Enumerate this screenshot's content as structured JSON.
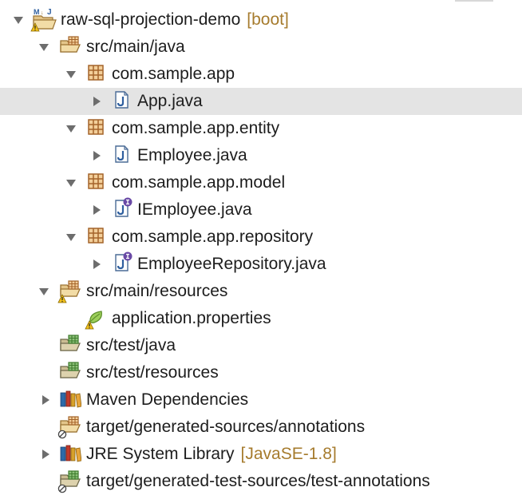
{
  "tree": {
    "project": {
      "name": "raw-sql-projection-demo",
      "decoration": "[boot]"
    },
    "src_main_java": {
      "label": "src/main/java"
    },
    "packages": [
      {
        "label": "com.sample.app",
        "file": "App.java"
      },
      {
        "label": "com.sample.app.entity",
        "file": "Employee.java"
      },
      {
        "label": "com.sample.app.model",
        "file": "IEmployee.java"
      },
      {
        "label": "com.sample.app.repository",
        "file": "EmployeeRepository.java"
      }
    ],
    "src_main_resources": {
      "label": "src/main/resources",
      "file": "application.properties"
    },
    "src_test_java": {
      "label": "src/test/java"
    },
    "src_test_resources": {
      "label": "src/test/resources"
    },
    "maven": {
      "label": "Maven Dependencies"
    },
    "target_annotations": {
      "label": "target/generated-sources/annotations"
    },
    "jre": {
      "label": "JRE System Library",
      "decoration": "[JavaSE-1.8]"
    },
    "target_test_annotations": {
      "label": "target/generated-test-sources/test-annotations"
    }
  },
  "colors": {
    "selection": "#e4e4e4",
    "decoration": "#a67b2d",
    "java_icon": "#2f5f9f",
    "interface_badge": "#6a4aa6",
    "package_icon": "#b5722a"
  }
}
